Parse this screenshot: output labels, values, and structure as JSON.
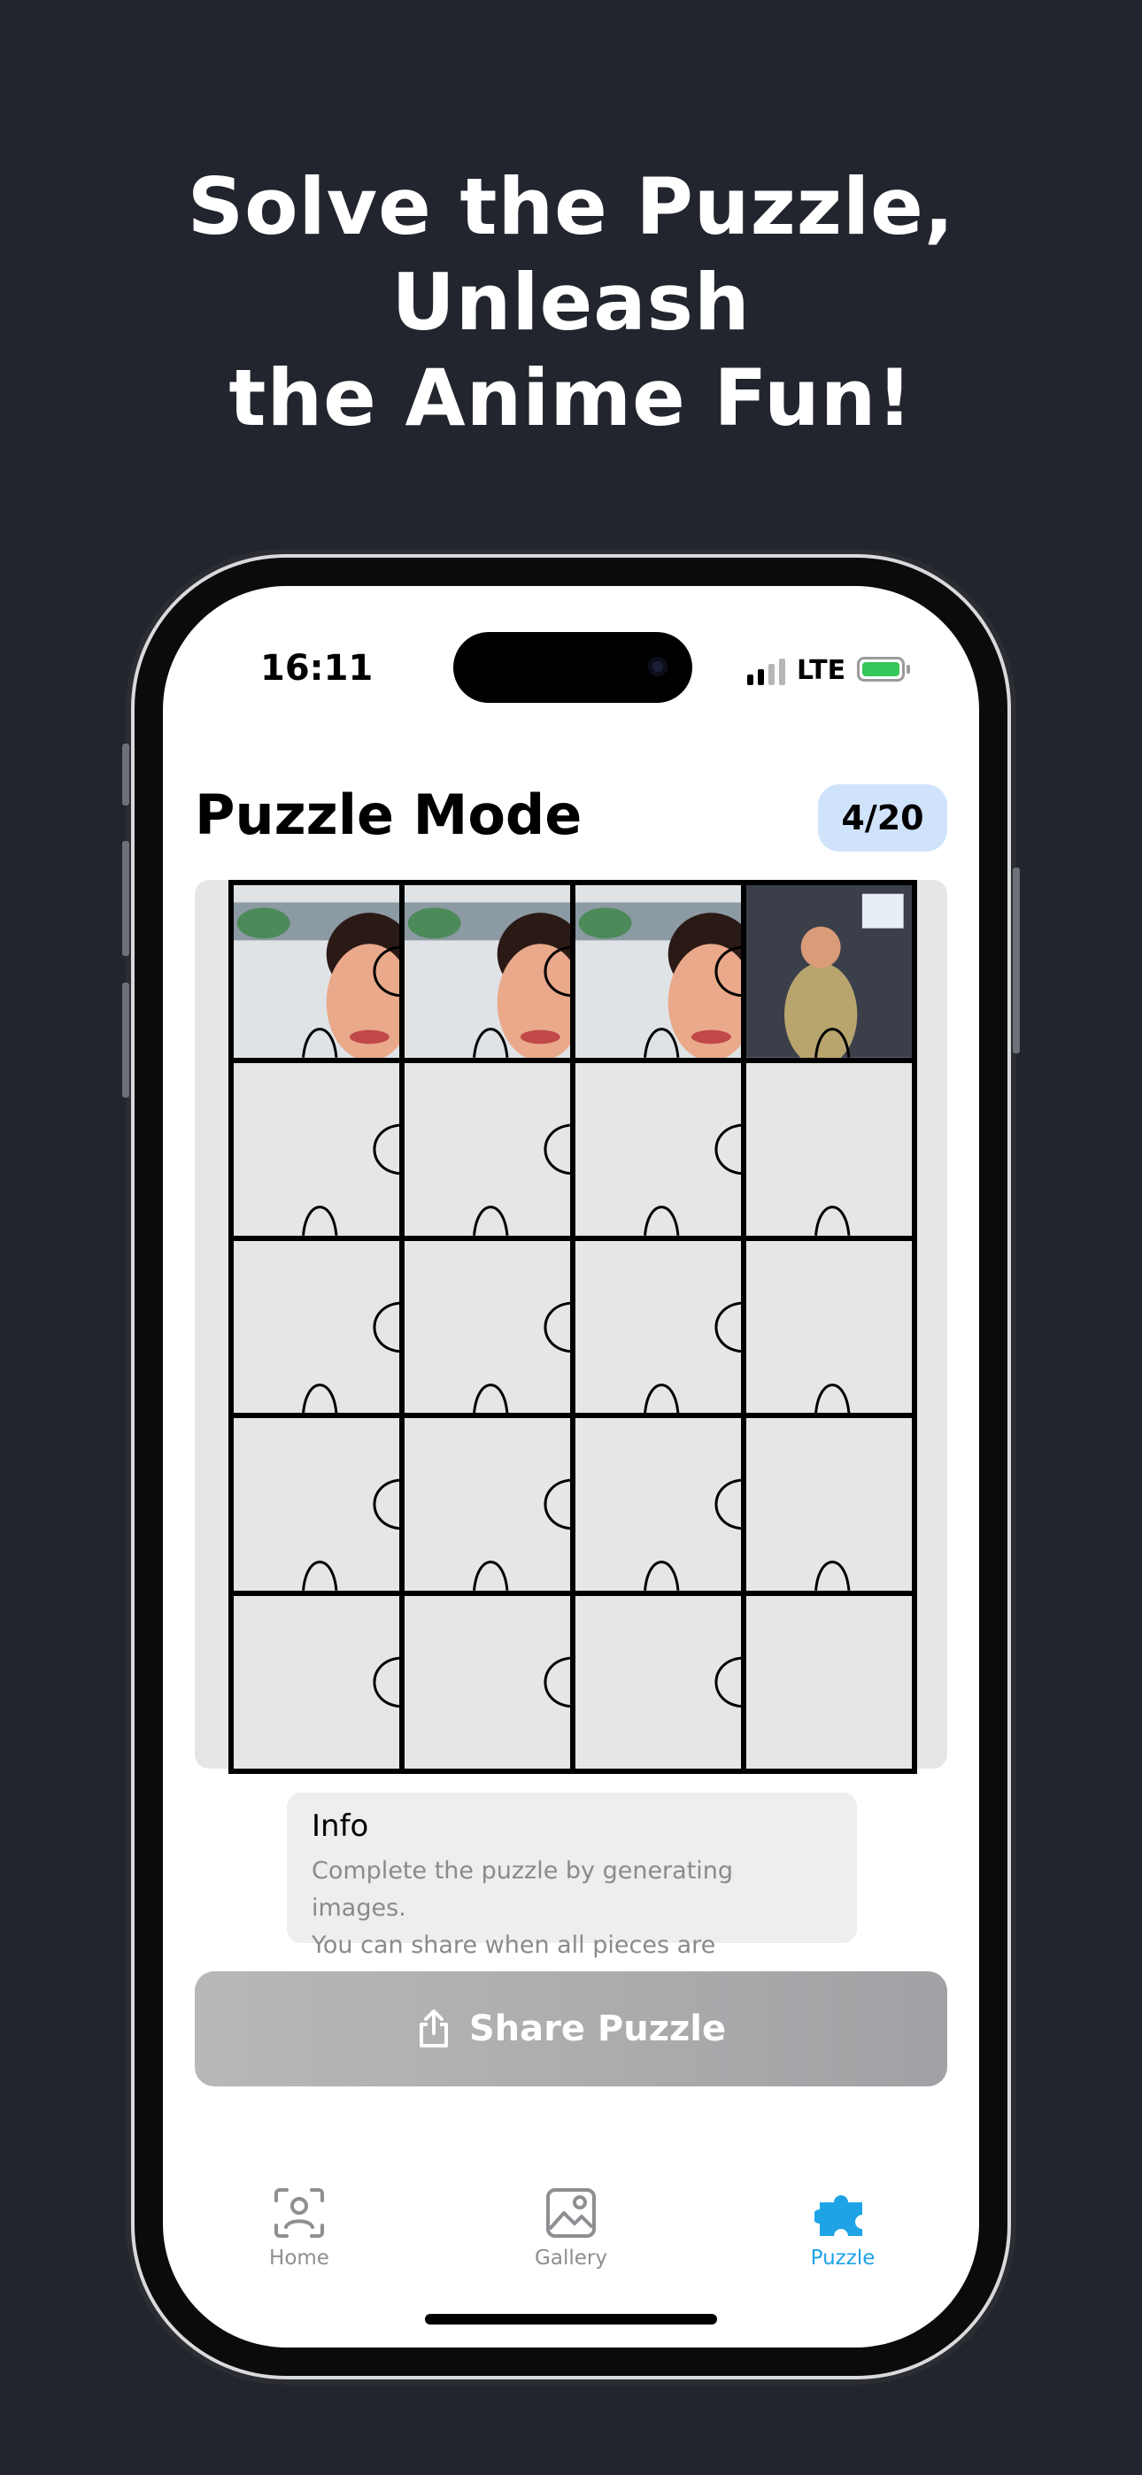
{
  "promo": {
    "headline_line1": "Solve the Puzzle, Unleash",
    "headline_line2": "the Anime Fun!"
  },
  "status_bar": {
    "time": "16:11",
    "network": "LTE",
    "battery_state": "charging"
  },
  "header": {
    "title": "Puzzle Mode",
    "progress_label": "4/20",
    "progress": {
      "collected": 4,
      "total": 20
    }
  },
  "puzzle": {
    "rows": 5,
    "columns": 4,
    "collected_pieces": [
      1,
      2,
      3,
      4
    ],
    "piece_images": [
      "anime face crop",
      "anime face crop",
      "anime face crop",
      "anime gym selfie"
    ]
  },
  "info": {
    "title": "Info",
    "line1": "Complete the puzzle by generating images.",
    "line2": "You can share when all pieces are collected."
  },
  "share": {
    "label": "Share Puzzle",
    "icon": "share-icon",
    "enabled": false
  },
  "tabs": [
    {
      "label": "Home",
      "icon": "face-scan-icon",
      "active": false
    },
    {
      "label": "Gallery",
      "icon": "image-icon",
      "active": false
    },
    {
      "label": "Puzzle",
      "icon": "puzzle-icon",
      "active": true
    }
  ],
  "colors": {
    "background": "#22252d",
    "accent": "#1da3e6",
    "counter_badge": "#cfe3fb",
    "battery": "#34c759"
  }
}
